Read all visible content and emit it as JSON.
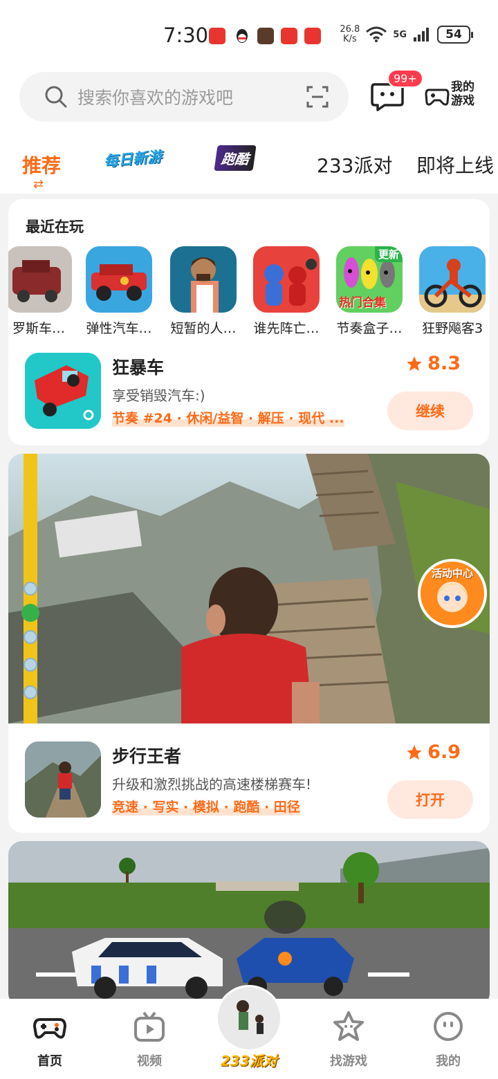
{
  "status_bar": {
    "time": "7:30",
    "net_speed_value": "26.8",
    "net_speed_unit": "K/s",
    "network": "5G",
    "battery": "54"
  },
  "header": {
    "search_placeholder": "搜索你喜欢的游戏吧",
    "message_badge": "99+",
    "my_games_line1": "我的",
    "my_games_line2": "游戏"
  },
  "tabs": [
    {
      "label": "推荐",
      "active": true
    },
    {
      "label": "每日新游"
    },
    {
      "label": "跑酷"
    },
    {
      "label": "233派对"
    },
    {
      "label": "即将上线"
    }
  ],
  "recent": {
    "title": "最近在玩",
    "items": [
      {
        "name": "罗斯车…",
        "color": "#8a2a2a"
      },
      {
        "name": "弹性汽车…",
        "color": "#2a9bd6"
      },
      {
        "name": "短暂的人…",
        "color": "#1d6f8e"
      },
      {
        "name": "谁先阵亡…",
        "color": "#3b6fd8"
      },
      {
        "name": "节奏盒子…",
        "color": "#5dd05d",
        "badge": "更新",
        "overlay": "热门合集"
      },
      {
        "name": "狂野飚客3",
        "color": "#4ab0e8"
      }
    ]
  },
  "current_game": {
    "name": "狂暴车",
    "description": "享受销毁汽车:)",
    "tags": "节奏 #24 · 休闲/益智 · 解压 · 现代 ...",
    "rating": "8.3",
    "action": "继续"
  },
  "featured_game": {
    "name": "步行王者",
    "description": "升级和激烈挑战的高速楼梯赛车!",
    "tags": "竞速 · 写实 · 模拟 · 跑酷 · 田径",
    "rating": "6.9",
    "action": "打开",
    "event_badge": "活动中心"
  },
  "bottom_nav": [
    {
      "label": "首页",
      "active": true
    },
    {
      "label": "视频"
    },
    {
      "label": "233派对"
    },
    {
      "label": "找游戏"
    },
    {
      "label": "我的"
    }
  ],
  "colors": {
    "accent": "#ff6a16",
    "badge_red": "#ff3b4e"
  }
}
